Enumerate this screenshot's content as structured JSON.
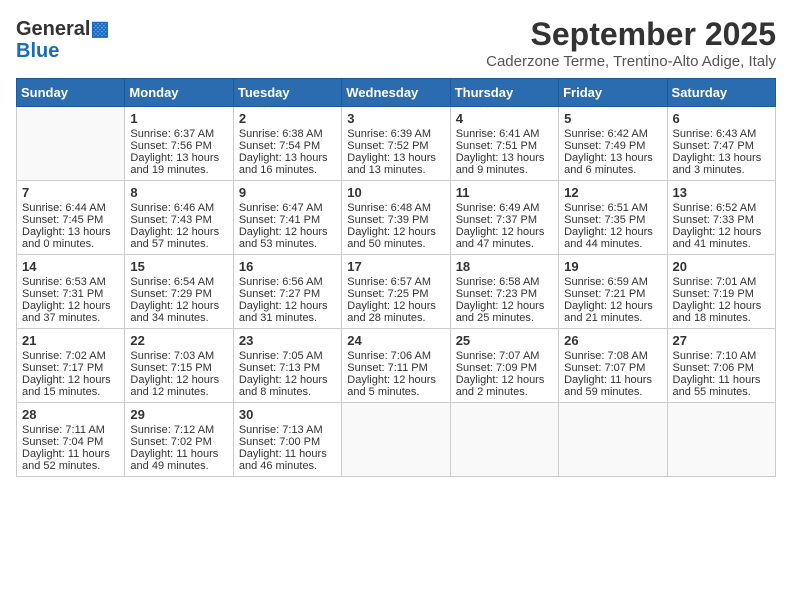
{
  "header": {
    "logo_line1": "General",
    "logo_line2": "Blue",
    "month_title": "September 2025",
    "location": "Caderzone Terme, Trentino-Alto Adige, Italy"
  },
  "weekdays": [
    "Sunday",
    "Monday",
    "Tuesday",
    "Wednesday",
    "Thursday",
    "Friday",
    "Saturday"
  ],
  "weeks": [
    [
      {
        "day": "",
        "content": ""
      },
      {
        "day": "1",
        "content": "Sunrise: 6:37 AM\nSunset: 7:56 PM\nDaylight: 13 hours\nand 19 minutes."
      },
      {
        "day": "2",
        "content": "Sunrise: 6:38 AM\nSunset: 7:54 PM\nDaylight: 13 hours\nand 16 minutes."
      },
      {
        "day": "3",
        "content": "Sunrise: 6:39 AM\nSunset: 7:52 PM\nDaylight: 13 hours\nand 13 minutes."
      },
      {
        "day": "4",
        "content": "Sunrise: 6:41 AM\nSunset: 7:51 PM\nDaylight: 13 hours\nand 9 minutes."
      },
      {
        "day": "5",
        "content": "Sunrise: 6:42 AM\nSunset: 7:49 PM\nDaylight: 13 hours\nand 6 minutes."
      },
      {
        "day": "6",
        "content": "Sunrise: 6:43 AM\nSunset: 7:47 PM\nDaylight: 13 hours\nand 3 minutes."
      }
    ],
    [
      {
        "day": "7",
        "content": "Sunrise: 6:44 AM\nSunset: 7:45 PM\nDaylight: 13 hours\nand 0 minutes."
      },
      {
        "day": "8",
        "content": "Sunrise: 6:46 AM\nSunset: 7:43 PM\nDaylight: 12 hours\nand 57 minutes."
      },
      {
        "day": "9",
        "content": "Sunrise: 6:47 AM\nSunset: 7:41 PM\nDaylight: 12 hours\nand 53 minutes."
      },
      {
        "day": "10",
        "content": "Sunrise: 6:48 AM\nSunset: 7:39 PM\nDaylight: 12 hours\nand 50 minutes."
      },
      {
        "day": "11",
        "content": "Sunrise: 6:49 AM\nSunset: 7:37 PM\nDaylight: 12 hours\nand 47 minutes."
      },
      {
        "day": "12",
        "content": "Sunrise: 6:51 AM\nSunset: 7:35 PM\nDaylight: 12 hours\nand 44 minutes."
      },
      {
        "day": "13",
        "content": "Sunrise: 6:52 AM\nSunset: 7:33 PM\nDaylight: 12 hours\nand 41 minutes."
      }
    ],
    [
      {
        "day": "14",
        "content": "Sunrise: 6:53 AM\nSunset: 7:31 PM\nDaylight: 12 hours\nand 37 minutes."
      },
      {
        "day": "15",
        "content": "Sunrise: 6:54 AM\nSunset: 7:29 PM\nDaylight: 12 hours\nand 34 minutes."
      },
      {
        "day": "16",
        "content": "Sunrise: 6:56 AM\nSunset: 7:27 PM\nDaylight: 12 hours\nand 31 minutes."
      },
      {
        "day": "17",
        "content": "Sunrise: 6:57 AM\nSunset: 7:25 PM\nDaylight: 12 hours\nand 28 minutes."
      },
      {
        "day": "18",
        "content": "Sunrise: 6:58 AM\nSunset: 7:23 PM\nDaylight: 12 hours\nand 25 minutes."
      },
      {
        "day": "19",
        "content": "Sunrise: 6:59 AM\nSunset: 7:21 PM\nDaylight: 12 hours\nand 21 minutes."
      },
      {
        "day": "20",
        "content": "Sunrise: 7:01 AM\nSunset: 7:19 PM\nDaylight: 12 hours\nand 18 minutes."
      }
    ],
    [
      {
        "day": "21",
        "content": "Sunrise: 7:02 AM\nSunset: 7:17 PM\nDaylight: 12 hours\nand 15 minutes."
      },
      {
        "day": "22",
        "content": "Sunrise: 7:03 AM\nSunset: 7:15 PM\nDaylight: 12 hours\nand 12 minutes."
      },
      {
        "day": "23",
        "content": "Sunrise: 7:05 AM\nSunset: 7:13 PM\nDaylight: 12 hours\nand 8 minutes."
      },
      {
        "day": "24",
        "content": "Sunrise: 7:06 AM\nSunset: 7:11 PM\nDaylight: 12 hours\nand 5 minutes."
      },
      {
        "day": "25",
        "content": "Sunrise: 7:07 AM\nSunset: 7:09 PM\nDaylight: 12 hours\nand 2 minutes."
      },
      {
        "day": "26",
        "content": "Sunrise: 7:08 AM\nSunset: 7:07 PM\nDaylight: 11 hours\nand 59 minutes."
      },
      {
        "day": "27",
        "content": "Sunrise: 7:10 AM\nSunset: 7:06 PM\nDaylight: 11 hours\nand 55 minutes."
      }
    ],
    [
      {
        "day": "28",
        "content": "Sunrise: 7:11 AM\nSunset: 7:04 PM\nDaylight: 11 hours\nand 52 minutes."
      },
      {
        "day": "29",
        "content": "Sunrise: 7:12 AM\nSunset: 7:02 PM\nDaylight: 11 hours\nand 49 minutes."
      },
      {
        "day": "30",
        "content": "Sunrise: 7:13 AM\nSunset: 7:00 PM\nDaylight: 11 hours\nand 46 minutes."
      },
      {
        "day": "",
        "content": ""
      },
      {
        "day": "",
        "content": ""
      },
      {
        "day": "",
        "content": ""
      },
      {
        "day": "",
        "content": ""
      }
    ]
  ]
}
